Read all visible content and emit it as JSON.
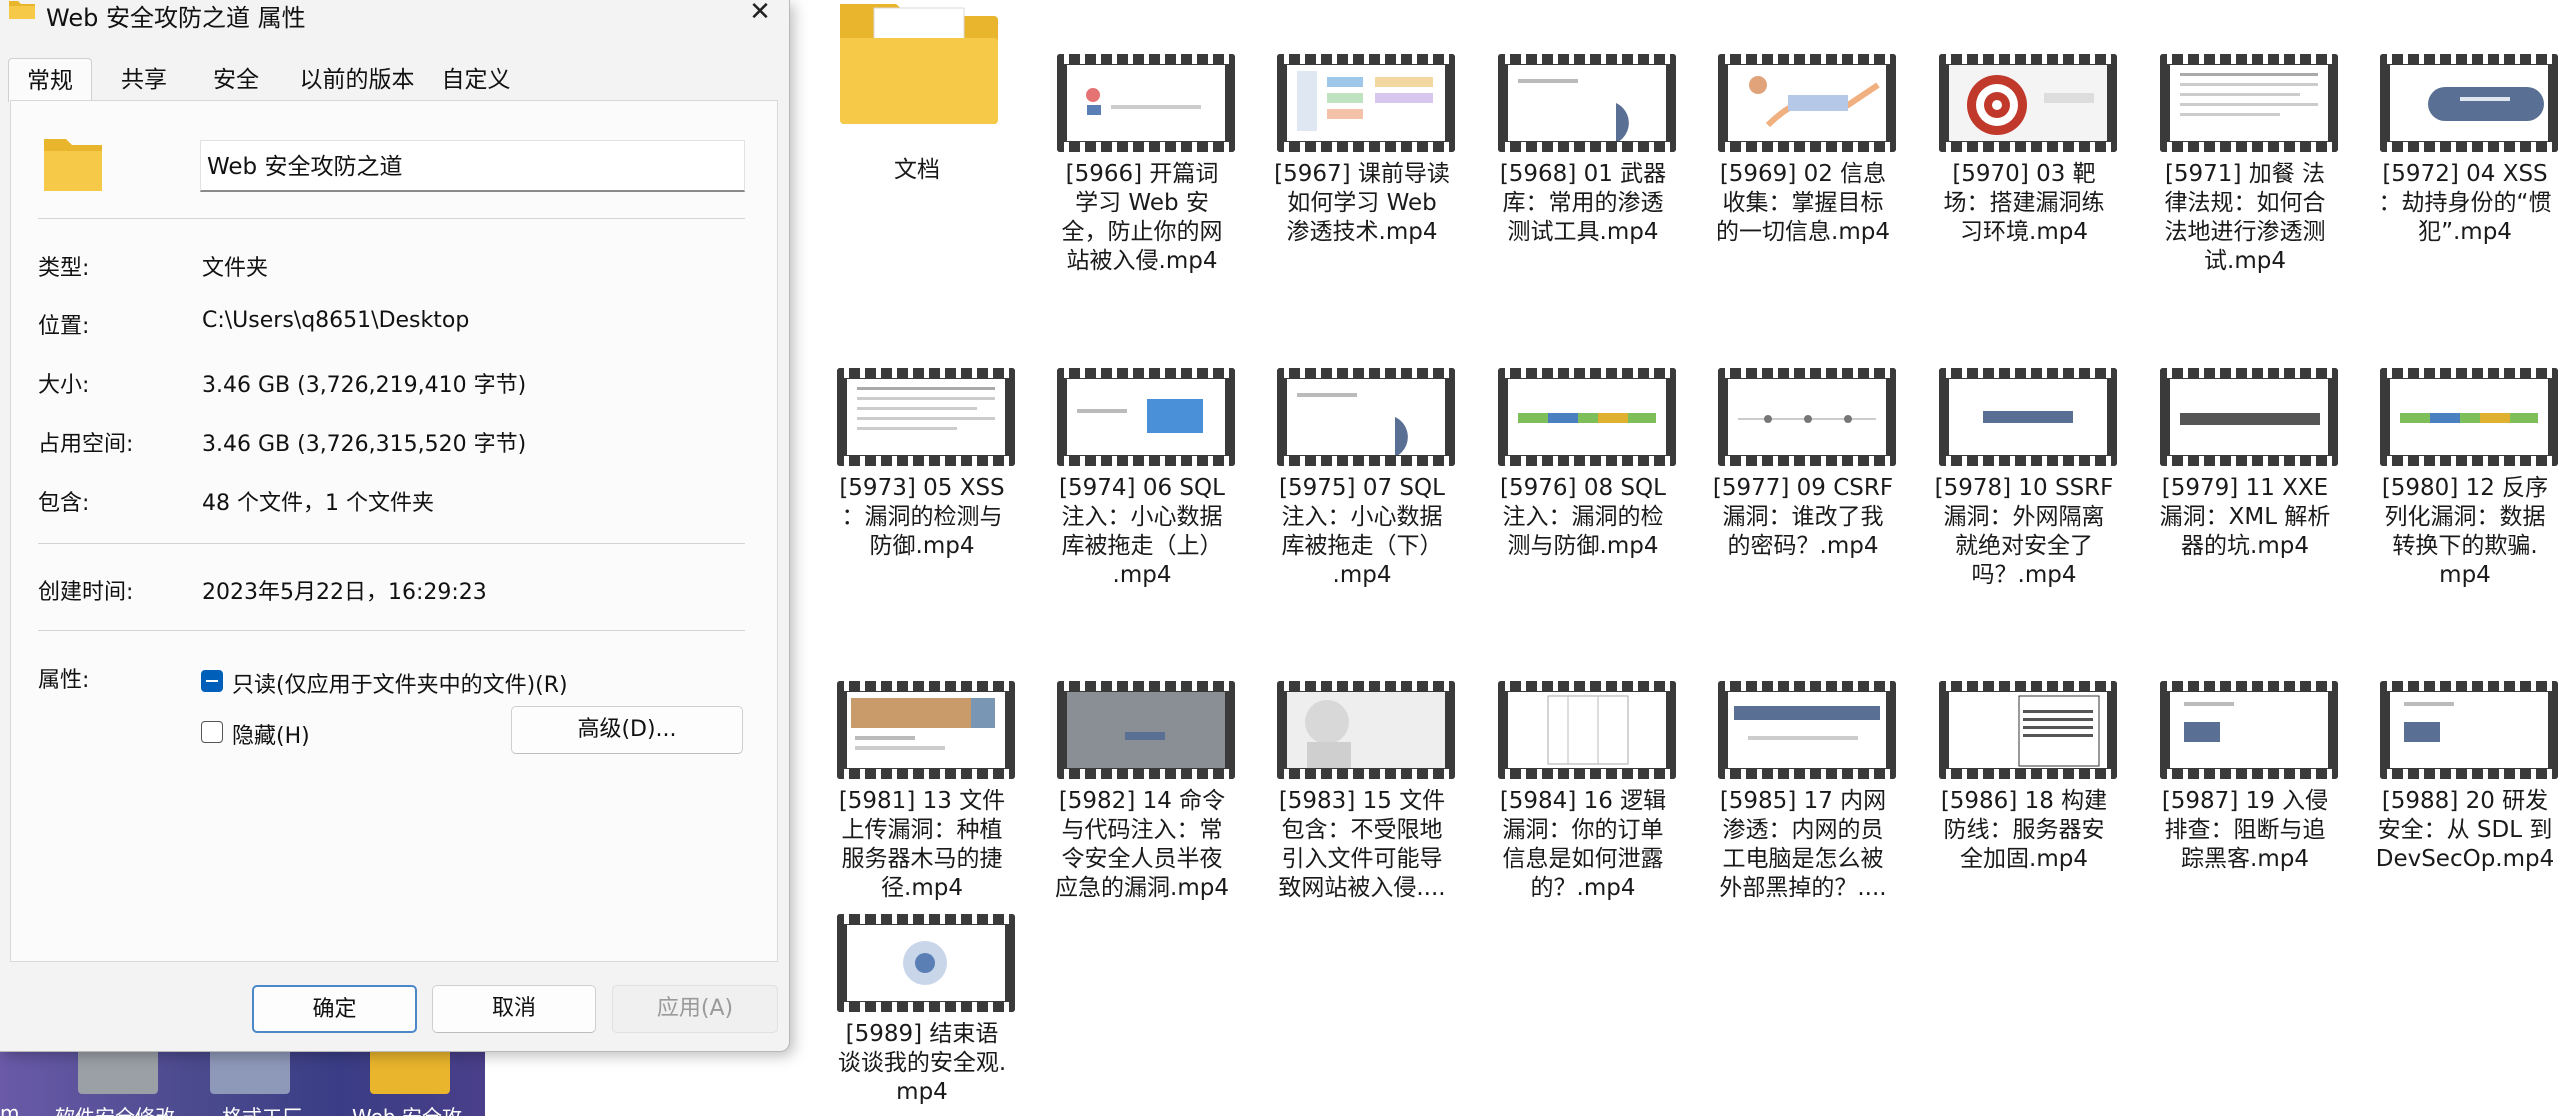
{
  "dialog": {
    "title": "Web 安全攻防之道 属性",
    "tabs": [
      "常规",
      "共享",
      "安全",
      "以前的版本",
      "自定义"
    ],
    "folder_name": "Web 安全攻防之道",
    "rows": [
      {
        "label": "类型:",
        "value": "文件夹"
      },
      {
        "label": "位置:",
        "value": "C:\\Users\\q8651\\Desktop"
      },
      {
        "label": "大小:",
        "value": "3.46 GB (3,726,219,410 字节)"
      },
      {
        "label": "占用空间:",
        "value": "3.46 GB (3,726,315,520 字节)"
      },
      {
        "label": "包含:",
        "value": "48 个文件，1 个文件夹"
      }
    ],
    "created_label": "创建时间:",
    "created_value": "2023年5月22日，16:29:23",
    "attributes_label": "属性:",
    "readonly_label": "只读(仅应用于文件夹中的文件)(R)",
    "hidden_label": "隐藏(H)",
    "advanced_button": "高级(D)...",
    "ok_button": "确定",
    "cancel_button": "取消",
    "apply_button": "应用(A)"
  },
  "desktop": {
    "labels": [
      "m",
      "软件安全修改",
      "格式工厂",
      "Web 安全攻"
    ]
  },
  "explorer": {
    "folder": {
      "name": "文档"
    },
    "files": [
      {
        "lines": [
          "[5966] 开篇词",
          "学习 Web 安",
          "全，防止你的网",
          "站被入侵.mp4"
        ]
      },
      {
        "lines": [
          "[5967] 课前导读",
          "如何学习 Web",
          "渗透技术.mp4"
        ]
      },
      {
        "lines": [
          "[5968] 01  武器",
          "库：常用的渗透",
          "测试工具.mp4"
        ]
      },
      {
        "lines": [
          "[5969] 02  信息",
          "收集：掌握目标",
          "的一切信息.mp4"
        ]
      },
      {
        "lines": [
          "[5970] 03  靶",
          "场：搭建漏洞练",
          "习环境.mp4"
        ]
      },
      {
        "lines": [
          "[5971] 加餐  法",
          "律法规：如何合",
          "法地进行渗透测",
          "试.mp4"
        ]
      },
      {
        "lines": [
          "[5972] 04  XSS",
          "：劫持身份的“惯",
          "犯”.mp4"
        ]
      },
      {
        "lines": [
          "[5973] 05  XSS",
          "：漏洞的检测与",
          "防御.mp4"
        ]
      },
      {
        "lines": [
          "[5974] 06  SQL",
          "注入：小心数据",
          "库被拖走（上）",
          ".mp4"
        ]
      },
      {
        "lines": [
          "[5975] 07  SQL",
          "注入：小心数据",
          "库被拖走（下）",
          ".mp4"
        ]
      },
      {
        "lines": [
          "[5976] 08  SQL",
          "注入：漏洞的检",
          "测与防御.mp4"
        ]
      },
      {
        "lines": [
          "[5977] 09  CSRF",
          "漏洞：谁改了我",
          "的密码？.mp4"
        ]
      },
      {
        "lines": [
          "[5978] 10  SSRF",
          "漏洞：外网隔离",
          "就绝对安全了",
          "吗？.mp4"
        ]
      },
      {
        "lines": [
          "[5979] 11  XXE",
          "漏洞：XML 解析",
          "器的坑.mp4"
        ]
      },
      {
        "lines": [
          "[5980] 12  反序",
          "列化漏洞：数据",
          "转换下的欺骗.",
          "mp4"
        ]
      },
      {
        "lines": [
          "[5981] 13  文件",
          "上传漏洞：种植",
          "服务器木马的捷",
          "径.mp4"
        ]
      },
      {
        "lines": [
          "[5982] 14  命令",
          "与代码注入：常",
          "令安全人员半夜",
          "应急的漏洞.mp4"
        ]
      },
      {
        "lines": [
          "[5983] 15  文件",
          "包含：不受限地",
          "引入文件可能导",
          "致网站被入侵...."
        ]
      },
      {
        "lines": [
          "[5984] 16  逻辑",
          "漏洞：你的订单",
          "信息是如何泄露",
          "的？.mp4"
        ]
      },
      {
        "lines": [
          "[5985] 17  内网",
          "渗透：内网的员",
          "工电脑是怎么被",
          "外部黑掉的？...."
        ]
      },
      {
        "lines": [
          "[5986] 18  构建",
          "防线：服务器安",
          "全加固.mp4"
        ]
      },
      {
        "lines": [
          "[5987] 19  入侵",
          "排查：阻断与追",
          "踪黑客.mp4"
        ]
      },
      {
        "lines": [
          "[5988] 20  研发",
          "安全：从 SDL 到",
          "DevSecOp.mp4"
        ]
      },
      {
        "lines": [
          "[5989] 结束语",
          "谈谈我的安全观.",
          "mp4"
        ]
      }
    ]
  },
  "colors": {
    "accent": "#005fb8",
    "folder_yellow": "#f7c948",
    "dialog_bg": "#f3f3f3"
  }
}
